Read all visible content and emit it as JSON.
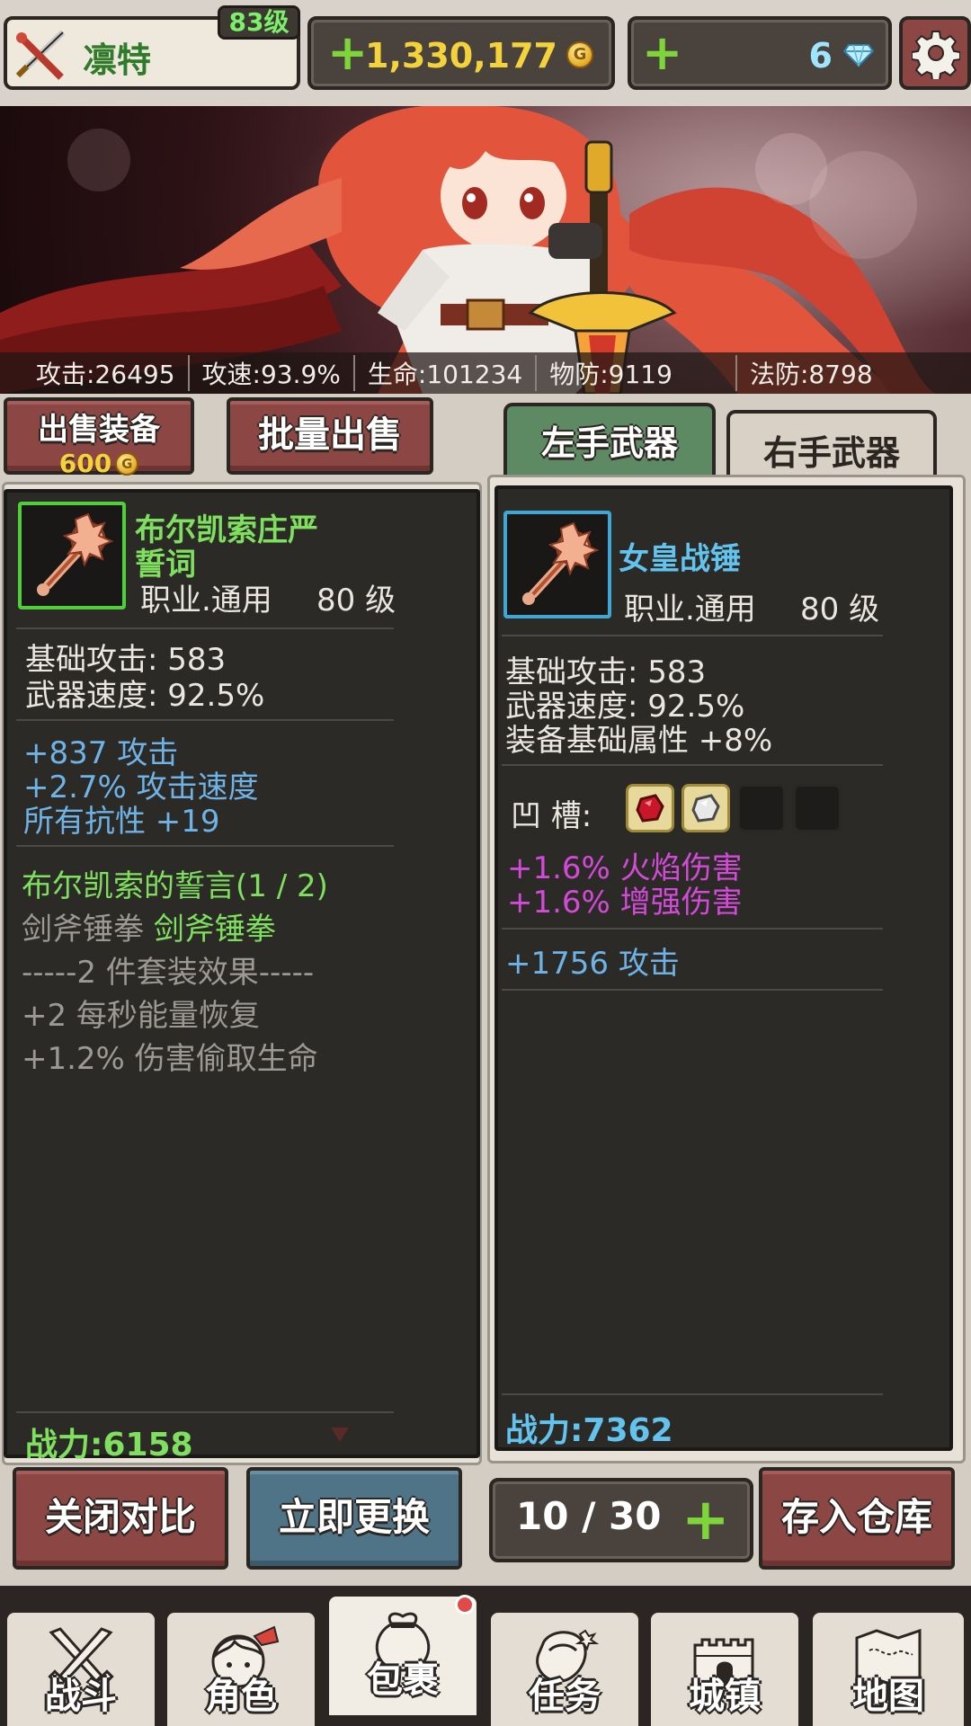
{
  "header": {
    "player_name": "凛特",
    "level": "83级",
    "gold": "1,330,177",
    "gold_coin_glyph": "G",
    "gems": "6"
  },
  "stats": [
    {
      "label": "攻击:26495"
    },
    {
      "label": "攻速:93.9%"
    },
    {
      "label": "生命:101234"
    },
    {
      "label": "物防:9119"
    },
    {
      "label": "法防:8798"
    }
  ],
  "actions": {
    "sell_label": "出售装备",
    "sell_price": "600",
    "bulk_sell_label": "批量出售",
    "close_compare_label": "关闭对比",
    "replace_label": "立即更换",
    "capacity": "10 / 30",
    "store_label": "存入仓库"
  },
  "tabs": {
    "left": "左手武器",
    "right": "右手武器"
  },
  "left_item": {
    "name_line1": "布尔凯索庄严",
    "name_line2": "誓词",
    "class": "职业.通用",
    "level": "80 级",
    "base_attack": "基础攻击:  583",
    "weapon_speed": "武器速度:  92.5%",
    "bonus": [
      "+837 攻击",
      "+2.7% 攻击速度",
      "所有抗性 +19"
    ],
    "set_name": "布尔凯索的誓言(1 / 2)",
    "set_parts_grey": "剑斧锤拳",
    "set_parts_green": "剑斧锤拳",
    "set_effect_header": "-----2 件套装效果-----",
    "set_effects": [
      "+2 每秒能量恢复",
      "+1.2% 伤害偷取生命"
    ],
    "power_label": "战力:",
    "power": "6158"
  },
  "right_item": {
    "name": "女皇战锤",
    "class": "职业.通用",
    "level": "80 级",
    "base_attack": "基础攻击:  583",
    "weapon_speed": "武器速度:  92.5%",
    "base_bonus": "装备基础属性 +8%",
    "socket_label": "凹   槽:",
    "socket_effects": [
      "+1.6% 火焰伤害",
      "+1.6% 增强伤害"
    ],
    "bonus": "+1756 攻击",
    "power_label": "战力:",
    "power": "7362"
  },
  "nav": [
    {
      "label": "战斗",
      "icon": "crossed-swords-icon"
    },
    {
      "label": "角色",
      "icon": "character-face-icon"
    },
    {
      "label": "包裹",
      "icon": "bag-icon"
    },
    {
      "label": "任务",
      "icon": "quest-icon"
    },
    {
      "label": "城镇",
      "icon": "castle-icon"
    },
    {
      "label": "地图",
      "icon": "map-icon"
    }
  ],
  "colors": {
    "accent_red": "#8c4744",
    "accent_blue": "#4f7387",
    "green_text": "#7ee05e",
    "blue_text": "#6fb3e6",
    "purple_text": "#d34ad9",
    "gold_text": "#f4d23a"
  }
}
